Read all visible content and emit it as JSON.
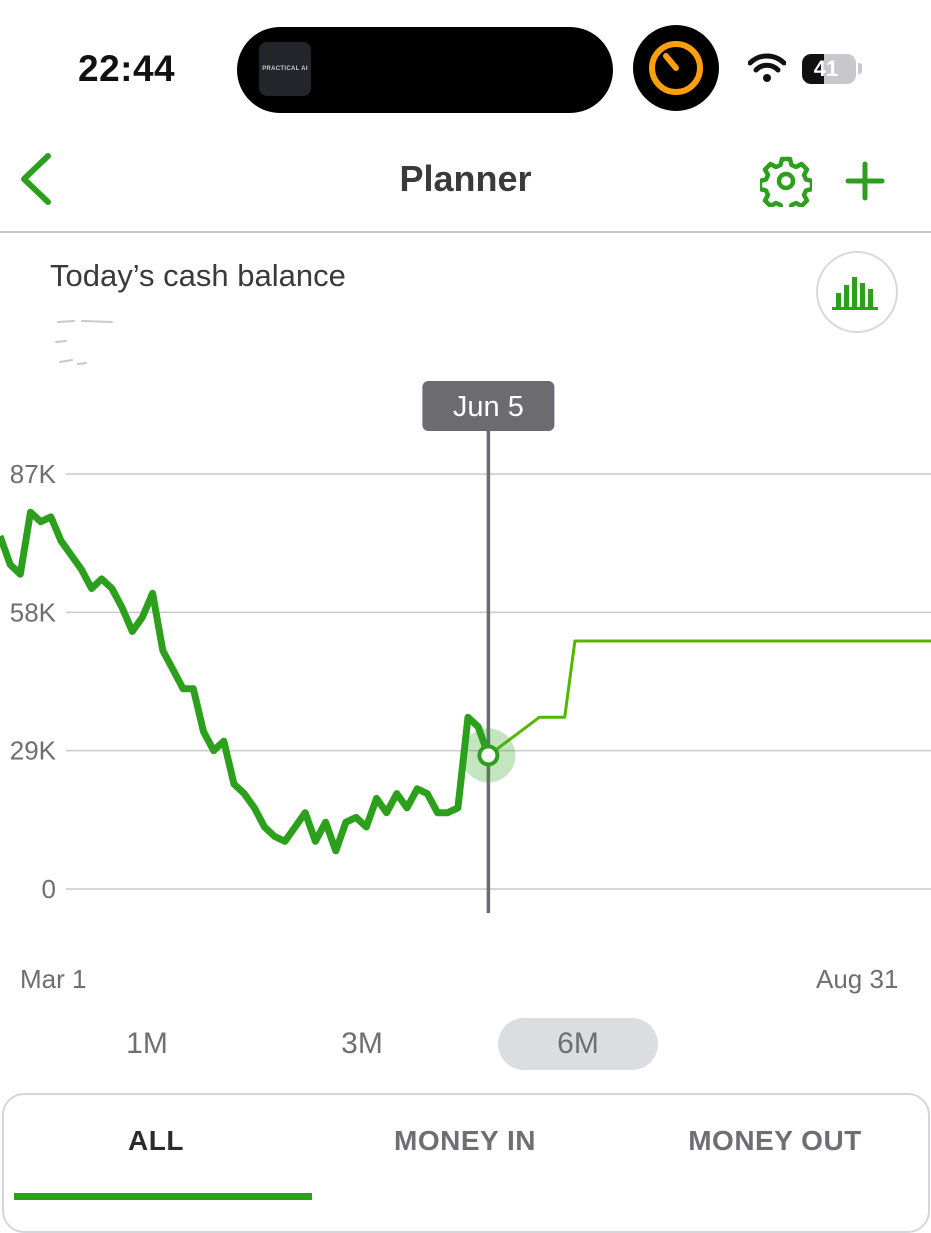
{
  "status_bar": {
    "time": "22:44",
    "island_app_label": "PRACTICAL AI",
    "battery_level": "41",
    "battery_fraction": 0.41
  },
  "header": {
    "title": "Planner",
    "back_icon": "chevron-left-icon",
    "settings_icon": "gear-icon",
    "add_icon": "plus-icon"
  },
  "balance": {
    "label": "Today’s cash balance",
    "toggle_icon": "bar-chart-icon"
  },
  "colors": {
    "brand_green": "#2ca01c",
    "forecast_green": "#53b700",
    "tooltip_bg": "#6b6b70"
  },
  "chart_data": {
    "type": "line",
    "title": "",
    "y_ticks": [
      "87K",
      "58K",
      "29K",
      "0"
    ],
    "y_tick_values": [
      87000,
      58000,
      29000,
      0
    ],
    "ylim": [
      0,
      87000
    ],
    "x_start_label": "Mar 1",
    "x_end_label": "Aug 31",
    "x_range": [
      "Mar 1",
      "Aug 31"
    ],
    "selected": {
      "label": "Jun 5",
      "value": 28000
    },
    "series": [
      {
        "kind": "actual",
        "x": [
          "Mar 1",
          "Mar 3",
          "Mar 5",
          "Mar 7",
          "Mar 9",
          "Mar 11",
          "Mar 13",
          "Mar 15",
          "Mar 17",
          "Mar 19",
          "Mar 21",
          "Mar 23",
          "Mar 25",
          "Mar 27",
          "Mar 29",
          "Mar 31",
          "Apr 2",
          "Apr 4",
          "Apr 6",
          "Apr 8",
          "Apr 10",
          "Apr 12",
          "Apr 14",
          "Apr 16",
          "Apr 18",
          "Apr 20",
          "Apr 22",
          "Apr 24",
          "Apr 26",
          "Apr 28",
          "Apr 30",
          "May 2",
          "May 4",
          "May 6",
          "May 8",
          "May 10",
          "May 12",
          "May 14",
          "May 16",
          "May 18",
          "May 20",
          "May 22",
          "May 24",
          "May 26",
          "May 28",
          "May 30",
          "Jun 1",
          "Jun 3",
          "Jun 5"
        ],
        "values": [
          74000,
          68000,
          66000,
          79000,
          77000,
          78000,
          73000,
          70000,
          67000,
          63000,
          65000,
          63000,
          59000,
          54000,
          57000,
          62000,
          50000,
          46000,
          42000,
          42000,
          33000,
          29000,
          31000,
          22000,
          20000,
          17000,
          13000,
          11000,
          10000,
          13000,
          16000,
          10000,
          14000,
          8000,
          14000,
          15000,
          13000,
          19000,
          16000,
          20000,
          17000,
          21000,
          20000,
          16000,
          16000,
          17000,
          36000,
          34000,
          28000
        ]
      },
      {
        "kind": "forecast",
        "x": [
          "Jun 5",
          "Jun 10",
          "Jun 15",
          "Jun 18",
          "Jun 20",
          "Jun 22",
          "Jun 28",
          "Jul 15",
          "Aug 1",
          "Aug 31"
        ],
        "values": [
          28000,
          32000,
          36000,
          36000,
          36000,
          52000,
          52000,
          52000,
          52000,
          52000
        ]
      }
    ]
  },
  "range_selector": {
    "options": [
      "1M",
      "3M",
      "6M"
    ],
    "selected": "6M"
  },
  "tabs": {
    "items": [
      "ALL",
      "MONEY IN",
      "MONEY OUT"
    ],
    "selected": "ALL"
  }
}
